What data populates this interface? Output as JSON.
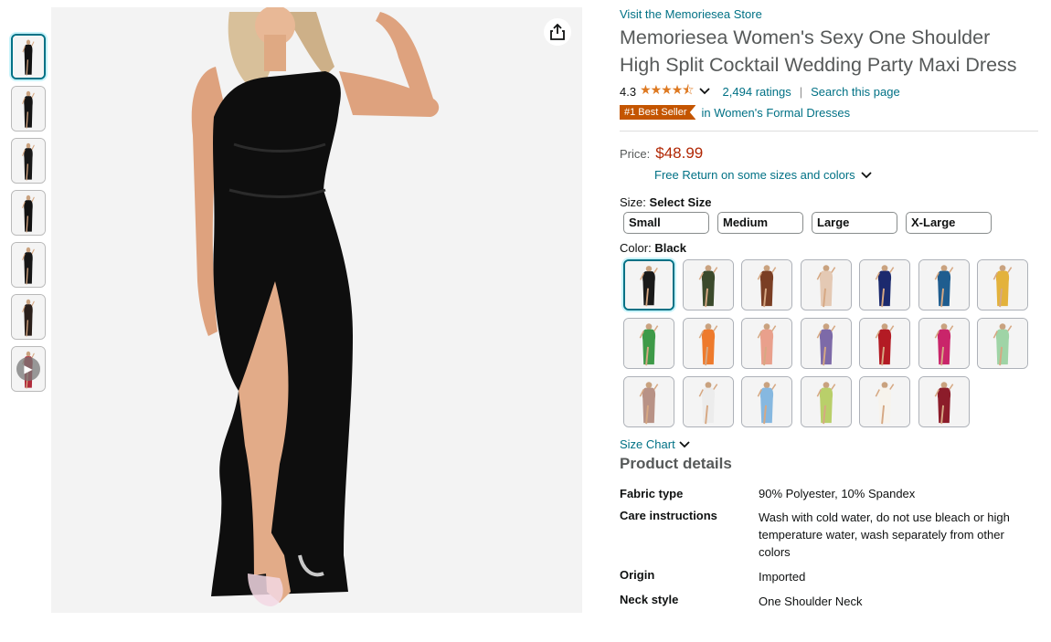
{
  "store_link": "Visit the Memoriesea Store",
  "title": "Memoriesea Women's Sexy One Shoulder High Split Cocktail Wedding Party Maxi Dress",
  "rating": {
    "value": "4.3",
    "stars": "★★★★⯪",
    "count_text": "2,494 ratings",
    "search_text": "Search this page"
  },
  "badge": {
    "label": "#1 Best Seller",
    "category": "in Women's Formal Dresses"
  },
  "price": {
    "label": "Price:",
    "value": "$48.99",
    "free_return": "Free Return on some sizes and colors"
  },
  "size": {
    "label": "Size:",
    "selected": "Select Size",
    "options": [
      "Small",
      "Medium",
      "Large",
      "X-Large"
    ]
  },
  "color": {
    "label": "Color:",
    "selected": "Black",
    "swatches": [
      "#1a1a1a",
      "#3b4a2c",
      "#7a3e24",
      "#e4c9b4",
      "#1c2a6e",
      "#1f5d8f",
      "#e3b23c",
      "#3e9a48",
      "#ee7a2c",
      "#e9a08c",
      "#7d6aa8",
      "#b31b24",
      "#c9256a",
      "#9fd4a6",
      "#b89286",
      "#ececec",
      "#86b8e0",
      "#b9cf6a",
      "#f7f3ec",
      "#8c1c2a"
    ]
  },
  "thumb_colors": [
    "#111111",
    "#151515",
    "#181818",
    "#121212",
    "#161616",
    "#2a1f1a",
    "#b02a3a"
  ],
  "size_chart": "Size Chart",
  "product_details": {
    "heading": "Product details",
    "rows": [
      {
        "key": "Fabric type",
        "value": "90% Polyester, 10% Spandex"
      },
      {
        "key": "Care instructions",
        "value": "Wash with cold water, do not use bleach or high temperature water, wash separately from other colors"
      },
      {
        "key": "Origin",
        "value": "Imported"
      },
      {
        "key": "Neck style",
        "value": "One Shoulder Neck"
      }
    ]
  }
}
